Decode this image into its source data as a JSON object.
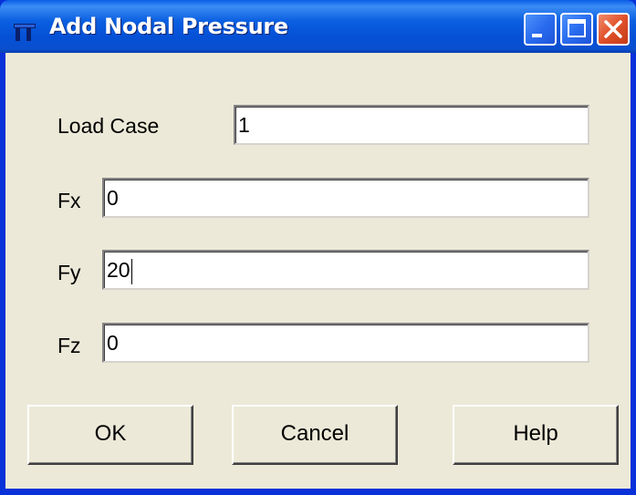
{
  "window": {
    "title": "Add Nodal Pressure"
  },
  "titlebar": {
    "icon": "app-icon",
    "buttons": [
      "minimize-icon",
      "maximize-icon",
      "close-icon"
    ]
  },
  "form": {
    "load_case": {
      "label": "Load Case",
      "value": "1"
    },
    "fx": {
      "label": "Fx",
      "value": "0"
    },
    "fy": {
      "label": "Fy",
      "value": "20"
    },
    "fz": {
      "label": "Fz",
      "value": "0"
    }
  },
  "buttons": {
    "ok": "OK",
    "cancel": "Cancel",
    "help": "Help"
  },
  "colors": {
    "titlebar": "#0550d6",
    "face": "#ece9d8",
    "close": "#e0512a"
  }
}
